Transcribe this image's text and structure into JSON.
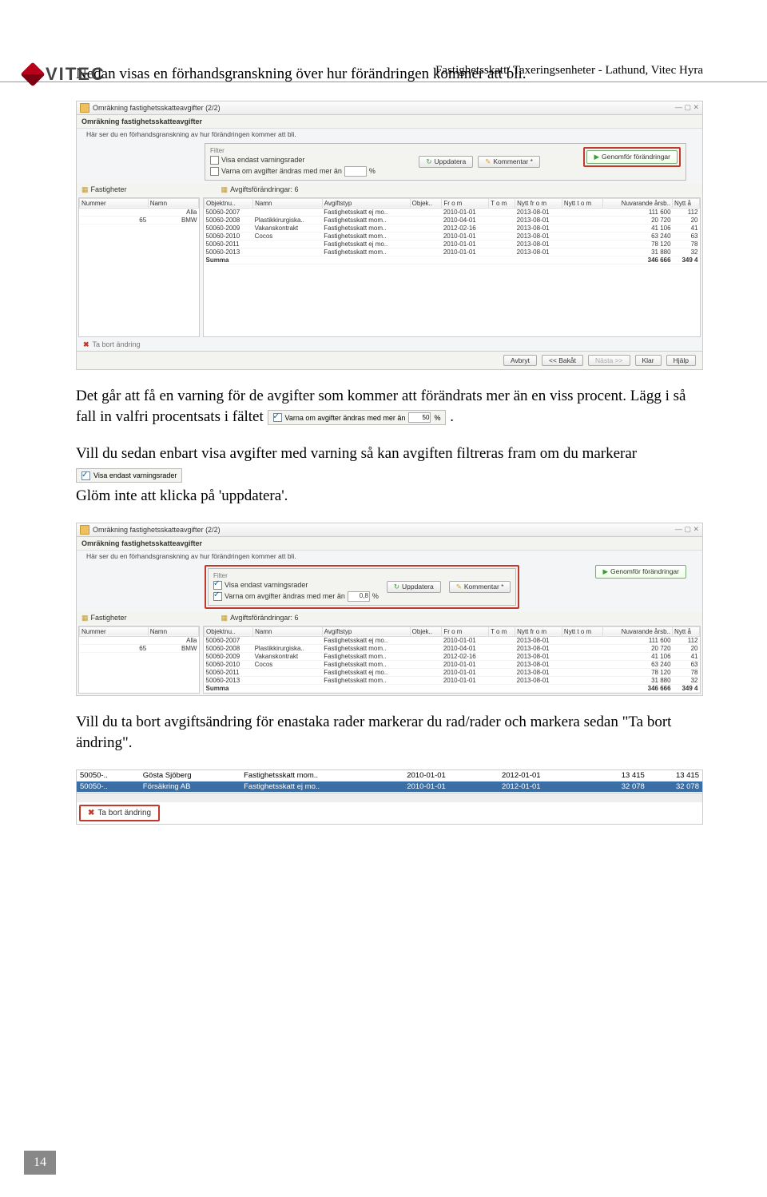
{
  "header": {
    "title": "Fastighetsskatt/ Taxeringsenheter - Lathund, Vitec Hyra",
    "logo_text": "VITEC"
  },
  "body": {
    "p1": "Nedan visas en förhandsgranskning över hur förändringen kommer att bli.",
    "p2a": "Det går att få en varning för de avgifter som kommer att förändrats mer än en viss procent. Lägg i så fall in valfri procentsats i fältet ",
    "p2b": ".",
    "p3a": "Vill du sedan enbart visa avgifter med varning så kan avgiften filtreras fram om du markerar ",
    "p3b": "Glöm inte att klicka på 'uppdatera'.",
    "p4": "Vill du ta bort avgiftsändring för enastaka rader markerar du rad/rader och markera sedan \"Ta bort ändring\"."
  },
  "inline_widgets": {
    "varn_label": "Varna om avgifter ändras med mer än",
    "varn_value": "50",
    "varn_pct": "%",
    "visa_endast": "Visa endast varningsrader"
  },
  "screenshot1": {
    "title": "Omräkning fastighetsskatteavgifter (2/2)",
    "sub": "Omräkning fastighetsskatteavgifter",
    "desc": "Här ser du en förhandsgranskning av hur förändringen kommer att bli.",
    "filter_label": "Filter",
    "visa_endast": "Visa endast varningsrader",
    "varna_label": "Varna om avgifter ändras med mer än",
    "varna_val": "",
    "pct": "%",
    "uppdatera": "Uppdatera",
    "kommentar": "Kommentar *",
    "genomfor": "Genomför förändringar",
    "fastigheter": "Fastigheter",
    "avgifts_title": "Avgiftsförändringar: 6",
    "cols": [
      "Nummer",
      "Namn",
      "Objektnu..",
      "Namn",
      "Avgiftstyp",
      "Objek..",
      "Fr o m",
      "T o m",
      "Nytt fr o m",
      "Nytt t o m",
      "Nuvarande årsb..",
      "Nytt å"
    ],
    "left_rows": [
      [
        "",
        "Alla"
      ],
      [
        "65",
        "BMW"
      ]
    ],
    "rows": [
      [
        "50060-2007",
        "",
        "Fastighetsskatt ej mo..",
        "",
        "2010-01-01",
        "",
        "2013-08-01",
        "",
        "111 600",
        "112"
      ],
      [
        "50060-2008",
        "Plastikkirurgiska..",
        "Fastighetsskatt mom..",
        "",
        "2010-04-01",
        "",
        "2013-08-01",
        "",
        "20 720",
        "20"
      ],
      [
        "50060-2009",
        "Vakanskontrakt",
        "Fastighetsskatt mom..",
        "",
        "2012-02-16",
        "",
        "2013-08-01",
        "",
        "41 106",
        "41"
      ],
      [
        "50060-2010",
        "Cocos",
        "Fastighetsskatt mom..",
        "",
        "2010-01-01",
        "",
        "2013-08-01",
        "",
        "63 240",
        "63"
      ],
      [
        "50060-2011",
        "",
        "Fastighetsskatt ej mo..",
        "",
        "2010-01-01",
        "",
        "2013-08-01",
        "",
        "78 120",
        "78"
      ],
      [
        "50060-2013",
        "",
        "Fastighetsskatt mom..",
        "",
        "2010-01-01",
        "",
        "2013-08-01",
        "",
        "31 880",
        "32"
      ],
      [
        "Summa",
        "",
        "",
        "",
        "",
        "",
        "",
        "",
        "346 666",
        "349 4"
      ]
    ],
    "tabort": "Ta bort ändring",
    "btns": [
      "Avbryt",
      "<< Bakåt",
      "Nästa >>",
      "Klar",
      "Hjälp"
    ]
  },
  "screenshot2": {
    "title": "Omräkning fastighetsskatteavgifter (2/2)",
    "sub": "Omräkning fastighetsskatteavgifter",
    "desc": "Här ser du en förhandsgranskning av hur förändringen kommer att bli.",
    "filter_label": "Filter",
    "visa_endast": "Visa endast varningsrader",
    "varna_label": "Varna om avgifter ändras med mer än",
    "varna_val": "0,8",
    "pct": "%",
    "uppdatera": "Uppdatera",
    "kommentar": "Kommentar *",
    "genomfor": "Genomför förändringar",
    "fastigheter": "Fastigheter",
    "avgifts_title": "Avgiftsförändringar: 6",
    "cols": [
      "Nummer",
      "Namn",
      "Objektnu..",
      "Namn",
      "Avgiftstyp",
      "Objek..",
      "Fr o m",
      "T o m",
      "Nytt fr o m",
      "Nytt t o m",
      "Nuvarande årsb..",
      "Nytt å"
    ],
    "left_rows": [
      [
        "",
        "Alla"
      ],
      [
        "65",
        "BMW"
      ]
    ],
    "rows": [
      [
        "50060-2007",
        "",
        "Fastighetsskatt ej mo..",
        "",
        "2010-01-01",
        "",
        "2013-08-01",
        "",
        "111 600",
        "112"
      ],
      [
        "50060-2008",
        "Plastikkirurgiska..",
        "Fastighetsskatt mom..",
        "",
        "2010-04-01",
        "",
        "2013-08-01",
        "",
        "20 720",
        "20"
      ],
      [
        "50060-2009",
        "Vakanskontrakt",
        "Fastighetsskatt mom..",
        "",
        "2012-02-16",
        "",
        "2013-08-01",
        "",
        "41 106",
        "41"
      ],
      [
        "50060-2010",
        "Cocos",
        "Fastighetsskatt mom..",
        "",
        "2010-01-01",
        "",
        "2013-08-01",
        "",
        "63 240",
        "63"
      ],
      [
        "50060-2011",
        "",
        "Fastighetsskatt ej mo..",
        "",
        "2010-01-01",
        "",
        "2013-08-01",
        "",
        "78 120",
        "78"
      ],
      [
        "50060-2013",
        "",
        "Fastighetsskatt mom..",
        "",
        "2010-01-01",
        "",
        "2013-08-01",
        "",
        "31 880",
        "32"
      ],
      [
        "Summa",
        "",
        "",
        "",
        "",
        "",
        "",
        "",
        "346 666",
        "349 4"
      ]
    ]
  },
  "screenshot3": {
    "rows": [
      [
        "50050-..",
        "Gösta Sjöberg",
        "Fastighetsskatt mom..",
        "",
        "2010-01-01",
        "",
        "2012-01-01",
        "",
        "13 415",
        "13 415"
      ],
      [
        "50050-..",
        "Försäkring AB",
        "Fastighetsskatt ej mo..",
        "",
        "2010-01-01",
        "",
        "2012-01-01",
        "",
        "32 078",
        "32 078"
      ]
    ],
    "tabort": "Ta bort ändring"
  },
  "page_number": "14"
}
